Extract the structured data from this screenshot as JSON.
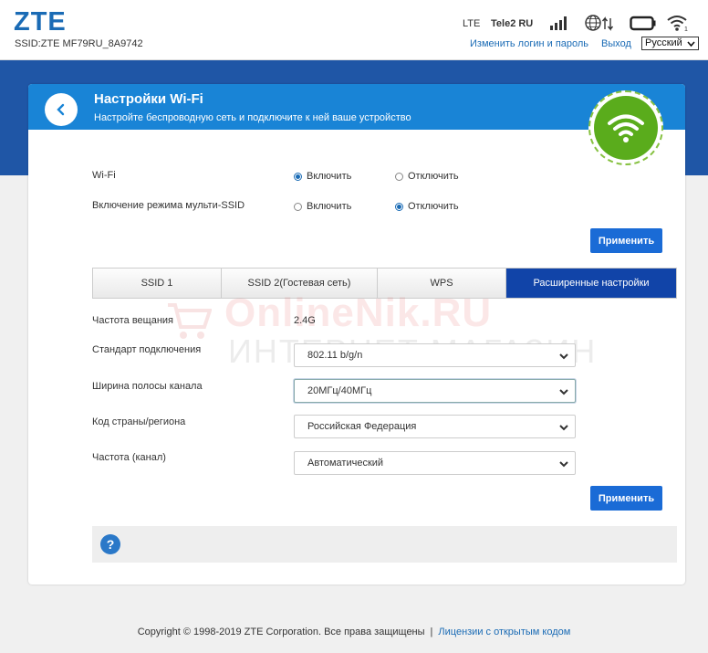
{
  "header": {
    "logo": "ZTE",
    "ssid": "SSID:ZTE MF79RU_8A9742",
    "network_type": "LTE",
    "operator": "Tele2 RU",
    "change_login_link": "Изменить логин и пароль",
    "logout_link": "Выход",
    "language": "Русский"
  },
  "card": {
    "title": "Настройки Wi-Fi",
    "subtitle": "Настройте беспроводную сеть и подключите к ней ваше устройство"
  },
  "wifi": {
    "label": "Wi-Fi",
    "on": "Включить",
    "off": "Отключить",
    "selected": "on"
  },
  "multi_ssid": {
    "label": "Включение режима мульти-SSID",
    "on": "Включить",
    "off": "Отключить",
    "selected": "off"
  },
  "apply_label": "Применить",
  "tabs": [
    {
      "label": "SSID 1",
      "active": false
    },
    {
      "label": "SSID 2(Гостевая сеть)",
      "active": false
    },
    {
      "label": "WPS",
      "active": false
    },
    {
      "label": "Расширенные настройки",
      "active": true
    }
  ],
  "advanced": {
    "frequency_label": "Частота вещания",
    "frequency_value": "2.4G",
    "standard_label": "Стандарт подключения",
    "standard_value": "802.11 b/g/n",
    "bandwidth_label": "Ширина полосы канала",
    "bandwidth_value": "20МГц/40МГц",
    "country_label": "Код страны/региона",
    "country_value": "Российская Федерация",
    "channel_label": "Частота (канал)",
    "channel_value": "Автоматический"
  },
  "watermark": {
    "line1": "OnlineNik.RU",
    "line2": "ИНТЕРНЕТ МАГАЗИН"
  },
  "footer": {
    "copyright": "Copyright © 1998-2019 ZTE Corporation. Все права защищены",
    "separator": "|",
    "license_link": "Лицензии с открытым кодом"
  },
  "colors": {
    "band": "#1f56a6",
    "card_header": "#1984d6",
    "active_tab": "#1144a8",
    "button": "#1a6bd6",
    "wifi_green": "#5aac1c"
  }
}
